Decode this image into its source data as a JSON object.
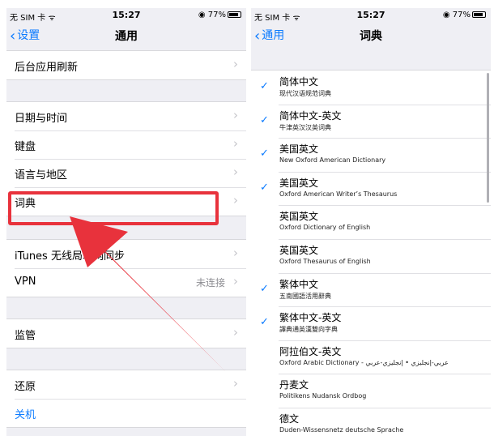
{
  "left": {
    "status": {
      "carrier": "无 SIM 卡",
      "time": "15:27",
      "battery": "77%"
    },
    "nav": {
      "back_label": "设置",
      "title": "通用"
    },
    "groups": [
      [
        "后台应用刷新"
      ],
      [
        "日期与时间",
        "键盘",
        "语言与地区",
        "词典"
      ],
      [
        "iTunes 无线局域网同步",
        "VPN"
      ],
      [
        "监管"
      ],
      [
        "还原",
        "关机"
      ]
    ],
    "vpn_value": "未连接"
  },
  "right": {
    "status": {
      "carrier": "无 SIM 卡",
      "time": "15:27",
      "battery": "77%"
    },
    "nav": {
      "back_label": "通用",
      "title": "词典"
    },
    "dictionaries": [
      {
        "name": "简体中文",
        "sub": "现代汉语规范词典",
        "checked": true
      },
      {
        "name": "简体中文-英文",
        "sub": "牛津英汉汉英词典",
        "checked": true
      },
      {
        "name": "美国英文",
        "sub": "New Oxford American Dictionary",
        "checked": true
      },
      {
        "name": "美国英文",
        "sub": "Oxford American Writer’s Thesaurus",
        "checked": true
      },
      {
        "name": "英国英文",
        "sub": "Oxford Dictionary of English",
        "checked": false
      },
      {
        "name": "英国英文",
        "sub": "Oxford Thesaurus of English",
        "checked": false
      },
      {
        "name": "繁体中文",
        "sub": "五南國語活用辭典",
        "checked": true
      },
      {
        "name": "繁体中文-英文",
        "sub": "譯典通英漢雙向字典",
        "checked": true
      },
      {
        "name": "阿拉伯文-英文",
        "sub": "Oxford Arabic Dictionary - عربي-إنجليزي • إنجليزي-عربي",
        "checked": false
      },
      {
        "name": "丹麦文",
        "sub": "Politikens Nudansk Ordbog",
        "checked": false
      },
      {
        "name": "德文",
        "sub": "Duden-Wissensnetz deutsche Sprache",
        "checked": false
      }
    ]
  },
  "colors": {
    "accent": "#0a7aff",
    "highlight": "#e8323c"
  },
  "icons": {
    "check": "checkmark-icon",
    "chevron": "chevron-right-icon",
    "back": "chevron-left-icon"
  }
}
